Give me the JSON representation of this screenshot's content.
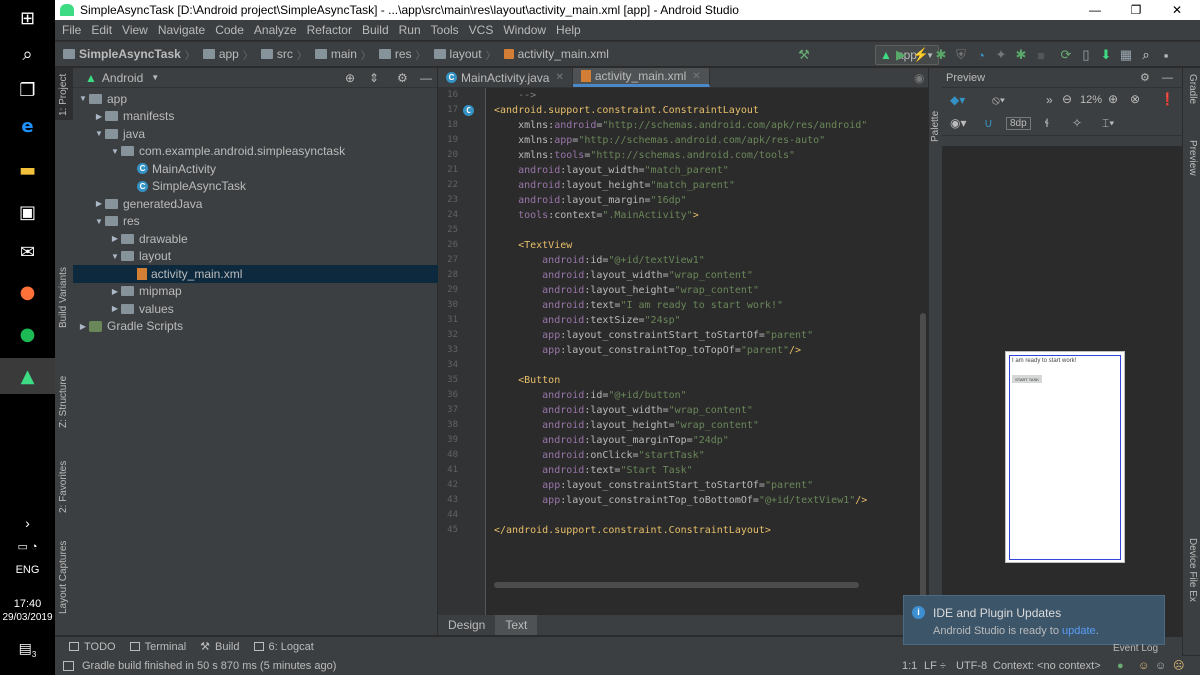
{
  "window": {
    "title": "SimpleAsyncTask [D:\\Android project\\SimpleAsyncTask] - ...\\app\\src\\main\\res\\layout\\activity_main.xml [app] - Android Studio",
    "minimize": "—",
    "maximize": "❐",
    "close": "✕"
  },
  "menu": [
    "File",
    "Edit",
    "View",
    "Navigate",
    "Code",
    "Analyze",
    "Refactor",
    "Build",
    "Run",
    "Tools",
    "VCS",
    "Window",
    "Help"
  ],
  "breadcrumb": [
    "SimpleAsyncTask",
    "app",
    "src",
    "main",
    "res",
    "layout",
    "activity_main.xml"
  ],
  "run_config": "app",
  "taskbar": {
    "lang": "ENG",
    "time": "17:40",
    "date": "29/03/2019",
    "notif_count": "3"
  },
  "left_stripe": {
    "project": "1: Project",
    "build_variants": "Build Variants",
    "structure": "Z: Structure",
    "favorites": "2: Favorites",
    "layout_captures": "Layout Captures"
  },
  "project_panel": {
    "view_mode": "Android",
    "tree": [
      {
        "label": "app",
        "depth": 0,
        "arrow": "▼",
        "icon": "folder"
      },
      {
        "label": "manifests",
        "depth": 1,
        "arrow": "▶",
        "icon": "folder"
      },
      {
        "label": "java",
        "depth": 1,
        "arrow": "▼",
        "icon": "folder"
      },
      {
        "label": "com.example.android.simpleasynctask",
        "depth": 2,
        "arrow": "▼",
        "icon": "folder"
      },
      {
        "label": "MainActivity",
        "depth": 3,
        "arrow": "",
        "icon": "class"
      },
      {
        "label": "SimpleAsyncTask",
        "depth": 3,
        "arrow": "",
        "icon": "class"
      },
      {
        "label": "generatedJava",
        "depth": 1,
        "arrow": "▶",
        "icon": "folder"
      },
      {
        "label": "res",
        "depth": 1,
        "arrow": "▼",
        "icon": "folder"
      },
      {
        "label": "drawable",
        "depth": 2,
        "arrow": "▶",
        "icon": "folder"
      },
      {
        "label": "layout",
        "depth": 2,
        "arrow": "▼",
        "icon": "folder"
      },
      {
        "label": "activity_main.xml",
        "depth": 3,
        "arrow": "",
        "icon": "xml",
        "selected": true
      },
      {
        "label": "mipmap",
        "depth": 2,
        "arrow": "▶",
        "icon": "folder"
      },
      {
        "label": "values",
        "depth": 2,
        "arrow": "▶",
        "icon": "folder"
      },
      {
        "label": "Gradle Scripts",
        "depth": 0,
        "arrow": "▶",
        "icon": "gradle"
      }
    ]
  },
  "editor": {
    "tabs": [
      {
        "label": "MainActivity.java",
        "active": false
      },
      {
        "label": "activity_main.xml",
        "active": true
      }
    ],
    "bottom_tabs": [
      "Design",
      "Text"
    ],
    "lines": [
      {
        "n": "16",
        "parts": [
          [
            "cmt",
            "    -->"
          ]
        ]
      },
      {
        "n": "17",
        "parts": [
          [
            "tag",
            "<android.support.constraint.ConstraintLayout"
          ]
        ]
      },
      {
        "n": "18",
        "parts": [
          [
            "attr",
            "    xmlns:"
          ],
          [
            "ns",
            "android"
          ],
          [
            "attr",
            "="
          ],
          [
            "val",
            "\"http://schemas.android.com/apk/res/android\""
          ]
        ]
      },
      {
        "n": "19",
        "parts": [
          [
            "attr",
            "    xmlns:"
          ],
          [
            "ns",
            "app"
          ],
          [
            "attr",
            "="
          ],
          [
            "val",
            "\"http://schemas.android.com/apk/res-auto\""
          ]
        ]
      },
      {
        "n": "20",
        "parts": [
          [
            "attr",
            "    xmlns:"
          ],
          [
            "ns",
            "tools"
          ],
          [
            "attr",
            "="
          ],
          [
            "val",
            "\"http://schemas.android.com/tools\""
          ]
        ]
      },
      {
        "n": "21",
        "parts": [
          [
            "ns",
            "    android"
          ],
          [
            "attr",
            ":layout_width="
          ],
          [
            "val",
            "\"match_parent\""
          ]
        ]
      },
      {
        "n": "22",
        "parts": [
          [
            "ns",
            "    android"
          ],
          [
            "attr",
            ":layout_height="
          ],
          [
            "val",
            "\"match_parent\""
          ]
        ]
      },
      {
        "n": "23",
        "parts": [
          [
            "ns",
            "    android"
          ],
          [
            "attr",
            ":layout_margin="
          ],
          [
            "val",
            "\"16dp\""
          ]
        ]
      },
      {
        "n": "24",
        "parts": [
          [
            "ns",
            "    tools"
          ],
          [
            "attr",
            ":context="
          ],
          [
            "val",
            "\".MainActivity\""
          ],
          [
            "tag",
            ">"
          ]
        ]
      },
      {
        "n": "25",
        "parts": [
          [
            "attr",
            ""
          ]
        ]
      },
      {
        "n": "26",
        "parts": [
          [
            "tag",
            "    <TextView"
          ]
        ]
      },
      {
        "n": "27",
        "parts": [
          [
            "ns",
            "        android"
          ],
          [
            "attr",
            ":id="
          ],
          [
            "val",
            "\"@+id/textView1\""
          ]
        ]
      },
      {
        "n": "28",
        "parts": [
          [
            "ns",
            "        android"
          ],
          [
            "attr",
            ":layout_width="
          ],
          [
            "val",
            "\"wrap_content\""
          ]
        ]
      },
      {
        "n": "29",
        "parts": [
          [
            "ns",
            "        android"
          ],
          [
            "attr",
            ":layout_height="
          ],
          [
            "val",
            "\"wrap_content\""
          ]
        ]
      },
      {
        "n": "30",
        "parts": [
          [
            "ns",
            "        android"
          ],
          [
            "attr",
            ":text="
          ],
          [
            "val",
            "\"I am ready to start work!\""
          ]
        ]
      },
      {
        "n": "31",
        "parts": [
          [
            "ns",
            "        android"
          ],
          [
            "attr",
            ":textSize="
          ],
          [
            "val",
            "\"24sp\""
          ]
        ]
      },
      {
        "n": "32",
        "parts": [
          [
            "ns",
            "        app"
          ],
          [
            "attr",
            ":layout_constraintStart_toStartOf="
          ],
          [
            "val",
            "\"parent\""
          ]
        ]
      },
      {
        "n": "33",
        "parts": [
          [
            "ns",
            "        app"
          ],
          [
            "attr",
            ":layout_constraintTop_toTopOf="
          ],
          [
            "val",
            "\"parent\""
          ],
          [
            "tag",
            "/>"
          ]
        ]
      },
      {
        "n": "34",
        "parts": [
          [
            "attr",
            ""
          ]
        ]
      },
      {
        "n": "35",
        "parts": [
          [
            "tag",
            "    <Button"
          ]
        ]
      },
      {
        "n": "36",
        "parts": [
          [
            "ns",
            "        android"
          ],
          [
            "attr",
            ":id="
          ],
          [
            "val",
            "\"@+id/button\""
          ]
        ]
      },
      {
        "n": "37",
        "parts": [
          [
            "ns",
            "        android"
          ],
          [
            "attr",
            ":layout_width="
          ],
          [
            "val",
            "\"wrap_content\""
          ]
        ]
      },
      {
        "n": "38",
        "parts": [
          [
            "ns",
            "        android"
          ],
          [
            "attr",
            ":layout_height="
          ],
          [
            "val",
            "\"wrap_content\""
          ]
        ]
      },
      {
        "n": "39",
        "parts": [
          [
            "ns",
            "        android"
          ],
          [
            "attr",
            ":layout_marginTop="
          ],
          [
            "val",
            "\"24dp\""
          ]
        ]
      },
      {
        "n": "40",
        "parts": [
          [
            "ns",
            "        android"
          ],
          [
            "attr",
            ":onClick="
          ],
          [
            "val",
            "\"startTask\""
          ]
        ]
      },
      {
        "n": "41",
        "parts": [
          [
            "ns",
            "        android"
          ],
          [
            "attr",
            ":text="
          ],
          [
            "val",
            "\"Start Task\""
          ]
        ]
      },
      {
        "n": "42",
        "parts": [
          [
            "ns",
            "        app"
          ],
          [
            "attr",
            ":layout_constraintStart_toStartOf="
          ],
          [
            "val",
            "\"parent\""
          ]
        ]
      },
      {
        "n": "43",
        "parts": [
          [
            "ns",
            "        app"
          ],
          [
            "attr",
            ":layout_constraintTop_toBottomOf="
          ],
          [
            "val",
            "\"@+id/textView1\""
          ],
          [
            "tag",
            "/>"
          ]
        ]
      },
      {
        "n": "44",
        "parts": [
          [
            "attr",
            ""
          ]
        ]
      },
      {
        "n": "45",
        "parts": [
          [
            "tag",
            "</android.support.constraint.ConstraintLayout>"
          ]
        ]
      }
    ]
  },
  "preview": {
    "title": "Preview",
    "zoom": "12%",
    "margin": "8dp",
    "phone_text": "I am ready to start work!",
    "phone_button": "START TASK",
    "palette_label": "Palette"
  },
  "right_stripe": {
    "gradle": "Gradle",
    "preview": "Preview",
    "device": "Device File Ex"
  },
  "bottom_tools": [
    "TODO",
    "Terminal",
    "Build",
    "6: Logcat"
  ],
  "status": {
    "message": "Gradle build finished in 50 s 870 ms (5 minutes ago)",
    "position": "1:1",
    "line_sep": "LF ÷",
    "encoding": "UTF-8",
    "context": "Context: <no context>",
    "event_log": "Event Log"
  },
  "notification": {
    "title": "IDE and Plugin Updates",
    "body": "Android Studio is ready to",
    "link": "update",
    "suffix": "."
  },
  "colors": {
    "accent": "#4a88c7",
    "run_green": "#3ddc84",
    "background": "#2b2b2b",
    "panel": "#3c3f41"
  }
}
